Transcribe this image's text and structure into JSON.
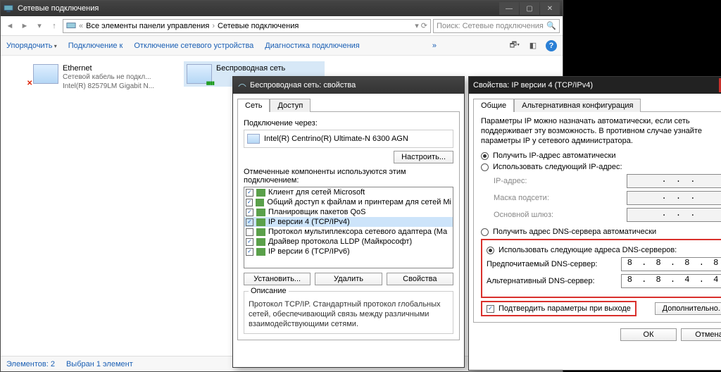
{
  "window": {
    "title": "Сетевые подключения",
    "breadcrumb_prefix": "«",
    "breadcrumb1": "Все элементы панели управления",
    "breadcrumb2": "Сетевые подключения",
    "search_placeholder": "Поиск: Сетевые подключения"
  },
  "toolbar": {
    "organize": "Упорядочить",
    "connect_to": "Подключение к",
    "disable": "Отключение сетевого устройства",
    "diagnose": "Диагностика подключения"
  },
  "connections": {
    "eth": {
      "name": "Ethernet",
      "status": "Сетевой кабель не подкл...",
      "device": "Intel(R) 82579LM Gigabit N..."
    },
    "wifi": {
      "name": "Беспроводная сеть"
    }
  },
  "status": {
    "count": "Элементов: 2",
    "selected": "Выбран 1 элемент"
  },
  "props": {
    "title": "Беспроводная сеть: свойства",
    "tab_net": "Сеть",
    "tab_access": "Доступ",
    "conn_via": "Подключение через:",
    "adapter": "Intel(R) Centrino(R) Ultimate-N 6300 AGN",
    "configure": "Настроить...",
    "components_label": "Отмеченные компоненты используются этим подключением:",
    "components": [
      {
        "checked": true,
        "label": "Клиент для сетей Microsoft"
      },
      {
        "checked": true,
        "label": "Общий доступ к файлам и принтерам для сетей Mi"
      },
      {
        "checked": true,
        "label": "Планировщик пакетов QoS"
      },
      {
        "checked": true,
        "label": "IP версии 4 (TCP/IPv4)",
        "selected": true
      },
      {
        "checked": false,
        "label": "Протокол мультиплексора сетевого адаптера (Ма"
      },
      {
        "checked": true,
        "label": "Драйвер протокола LLDP (Майкрософт)"
      },
      {
        "checked": true,
        "label": "IP версии 6 (TCP/IPv6)"
      }
    ],
    "install": "Установить...",
    "remove": "Удалить",
    "properties": "Свойства",
    "desc_label": "Описание",
    "desc": "Протокол TCP/IP. Стандартный протокол глобальных сетей, обеспечивающий связь между различными взаимодействующими сетями."
  },
  "ipv4": {
    "title": "Свойства: IP версии 4 (TCP/IPv4)",
    "tab_general": "Общие",
    "tab_alt": "Альтернативная конфигурация",
    "info": "Параметры IP можно назначать автоматически, если сеть поддерживает эту возможность. В противном случае узнайте параметры IP у сетевого администратора.",
    "ip_auto": "Получить IP-адрес автоматически",
    "ip_manual": "Использовать следующий IP-адрес:",
    "ip_addr": "IP-адрес:",
    "mask": "Маска подсети:",
    "gateway": "Основной шлюз:",
    "dns_auto": "Получить адрес DNS-сервера автоматически",
    "dns_manual": "Использовать следующие адреса DNS-серверов:",
    "dns_pref": "Предпочитаемый DNS-сервер:",
    "dns_alt": "Альтернативный DNS-сервер:",
    "dns_pref_val": "8 . 8 . 8 . 8",
    "dns_alt_val": "8 . 8 . 4 . 4",
    "validate": "Подтвердить параметры при выходе",
    "advanced": "Дополнительно...",
    "ok": "ОК",
    "cancel": "Отмена",
    "dots": ".       .       ."
  }
}
